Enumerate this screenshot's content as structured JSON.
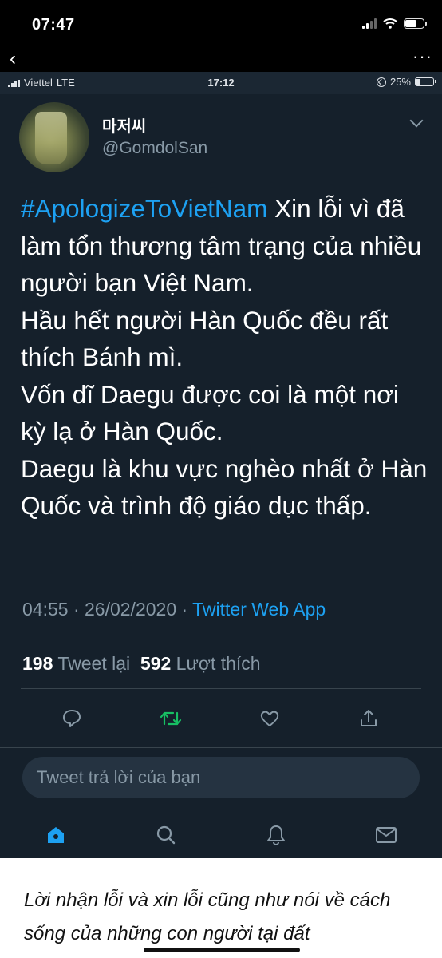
{
  "outer_status": {
    "time": "07:47"
  },
  "inner_status": {
    "carrier": "Viettel",
    "network": "LTE",
    "time": "17:12",
    "battery": "25%"
  },
  "tweet": {
    "display_name": "마저씨",
    "handle": "@GomdolSan",
    "hashtag": "#ApologizeToVietNam",
    "text_after_hashtag": " Xin lỗi vì đã làm tổn thương tâm trạng của nhiều người bạn Việt Nam.",
    "lines": [
      "Hầu hết người Hàn Quốc đều rất thích Bánh mì.",
      "Vốn dĩ Daegu được coi là một nơi kỳ lạ ở Hàn Quốc.",
      "Daegu là khu vực nghèo nhất ở Hàn Quốc và trình độ giáo dục thấp."
    ],
    "timestamp": "04:55 · 26/02/2020 · ",
    "source_app": "Twitter Web App",
    "retweet_count": "198",
    "retweet_label": " Tweet lại  ",
    "like_count": "592",
    "like_label": " Lượt thích"
  },
  "reply": {
    "placeholder": "Tweet trả lời của bạn"
  },
  "icons": {
    "back": "chevron-left-icon",
    "more": "more-dots-icon",
    "reply": "comment-icon",
    "retweet": "retweet-icon",
    "like": "heart-icon",
    "share": "share-icon",
    "home": "home-icon",
    "search": "search-icon",
    "notifications": "bell-icon",
    "messages": "mail-icon"
  },
  "colors": {
    "accent": "#1da1f2",
    "retweet": "#17bf63",
    "background": "#15202b",
    "muted": "#8899a6"
  },
  "caption": {
    "text": "Lời nhận lỗi và xin lỗi cũng như nói về cách sống của những con người tại đất"
  }
}
